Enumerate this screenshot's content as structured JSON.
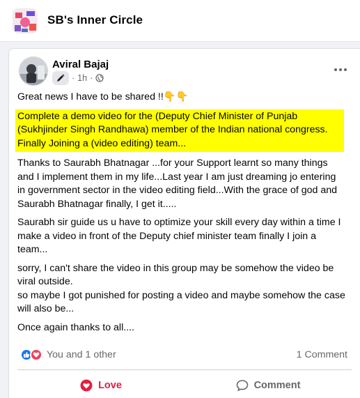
{
  "group": {
    "title": "SB's Inner Circle"
  },
  "post": {
    "author": "Aviral Bajaj",
    "time": "1h",
    "dot": "·",
    "paragraphs": {
      "intro": "Great news I have to be shared !!👇👇",
      "highlight": "Complete a demo video for the (Deputy Chief Minister of Punjab (Sukhjinder Singh Randhawa) member of the Indian national congress. Finally Joining a  (video editing) team...",
      "thanks": "Thanks to Saurabh Bhatnagar ...for your Support learnt so many things and I implement them in my life...Last year I am just dreaming jo entering in government sector in the video editing field...With the grace of god and Saurabh Bhatnagar finally, I get it.....",
      "guide": "Saurabh sir guide us u have to optimize your skill every day within a time I make a video in front of the Deputy chief minister team finally I join a team...",
      "sorry1": "sorry, I can't share the video in this group may be somehow the video be viral outside.",
      "sorry2": "so maybe I got punished for posting a video and maybe somehow the case will also be...",
      "closing": "Once again thanks to all...."
    },
    "reactions": {
      "summary": "You and 1 other",
      "icons": [
        "like-icon",
        "love-icon"
      ]
    },
    "comments_count": "1 Comment",
    "actions": {
      "love": "Love",
      "comment": "Comment"
    }
  },
  "colors": {
    "highlight": "#ffff00",
    "love": "#e41e3f",
    "like": "#1877f2",
    "muted": "#65676b"
  }
}
